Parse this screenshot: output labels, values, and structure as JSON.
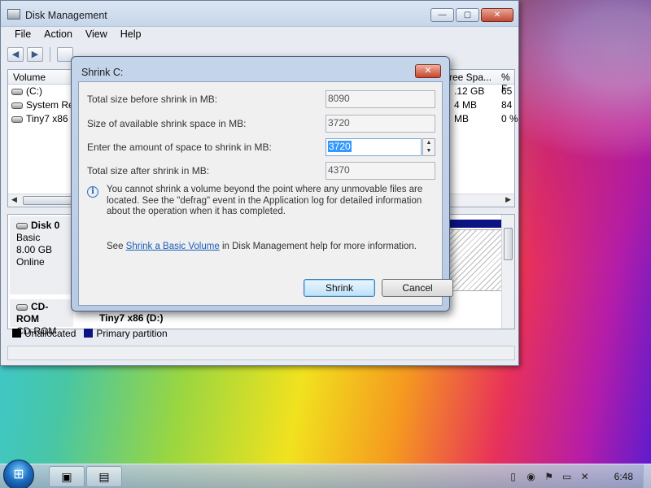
{
  "window": {
    "title": "Disk Management",
    "min": "—",
    "max": "▢",
    "close": "✕"
  },
  "menu": {
    "file": "File",
    "action": "Action",
    "view": "View",
    "help": "Help"
  },
  "toolbar": {
    "back": "◀",
    "forward": "▶"
  },
  "volumes": {
    "columns": {
      "volume": "Volume",
      "free_space": "ree Spa...",
      "pct": "% F"
    },
    "rows": [
      {
        "name": "(C:)",
        "free": ".12 GB",
        "pct": "65"
      },
      {
        "name": "System Res",
        "free": "4 MB",
        "pct": "84"
      },
      {
        "name": "Tiny7 x86 (",
        "free": "MB",
        "pct": "0 %"
      }
    ]
  },
  "disks": {
    "disk0": {
      "name": "Disk 0",
      "type": "Basic",
      "size": "8.00 GB",
      "status": "Online"
    },
    "cdrom": {
      "name": "CD-ROM",
      "type": "CD-ROM",
      "partition": "Tiny7 x86  (D:)"
    }
  },
  "legend": {
    "unallocated": "Unallocated",
    "primary": "Primary partition",
    "unallocated_color": "#000000",
    "primary_color": "#0c1483"
  },
  "dialog": {
    "title": "Shrink C:",
    "close": "✕",
    "fields": {
      "total_before_label": "Total size before shrink in MB:",
      "total_before_value": "8090",
      "available_label": "Size of available shrink space in MB:",
      "available_value": "3720",
      "amount_label": "Enter the amount of space to shrink in MB:",
      "amount_value": "3720",
      "total_after_label": "Total size after shrink in MB:",
      "total_after_value": "4370"
    },
    "info": "You cannot shrink a volume beyond the point where any unmovable files are located. See the \"defrag\" event in the Application log for detailed information about the operation when it has completed.",
    "see_prefix": "See",
    "see_link": "Shrink a Basic Volume",
    "see_suffix": "in Disk Management help for more information.",
    "shrink_button": "Shrink",
    "cancel_button": "Cancel"
  },
  "taskbar": {
    "clock": "6:48"
  }
}
